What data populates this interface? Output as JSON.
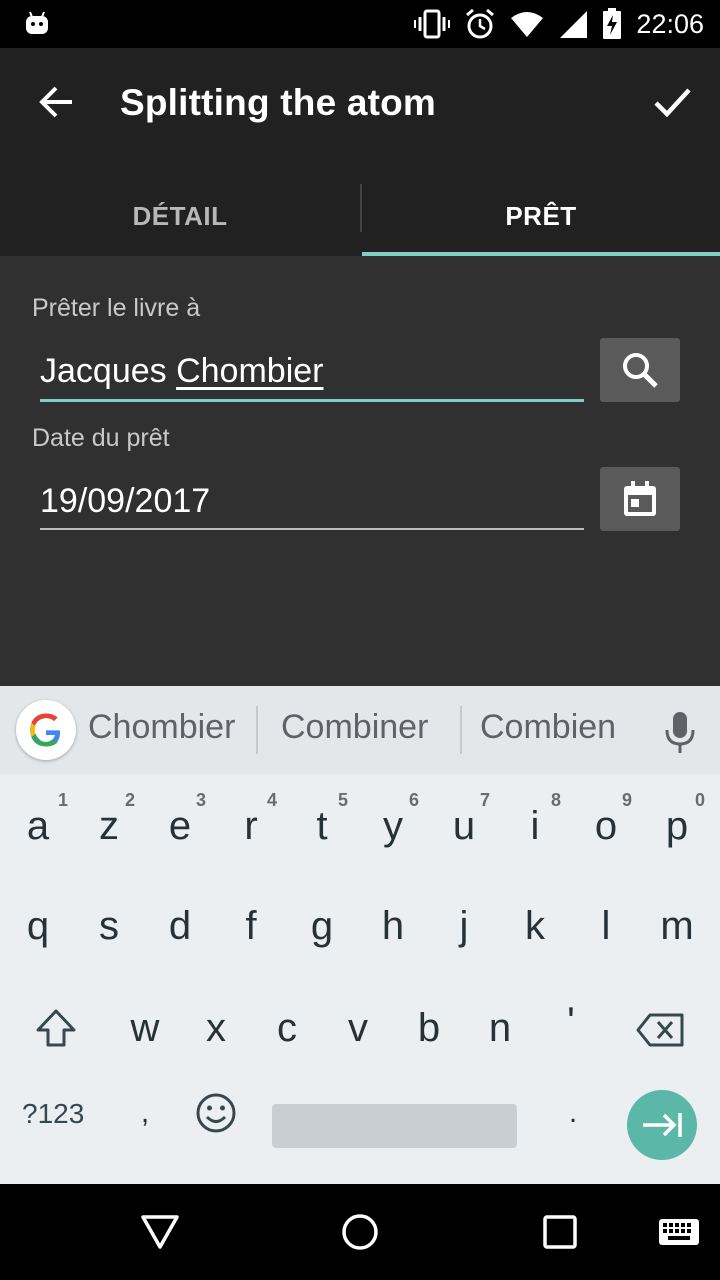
{
  "status_bar": {
    "time": "22:06",
    "icons": [
      "android-debug-icon",
      "vibrate-icon",
      "alarm-icon",
      "wifi-icon",
      "signal-icon",
      "battery-charging-icon"
    ]
  },
  "app_bar": {
    "title": "Splitting the atom",
    "back_icon": "arrow-back-icon",
    "confirm_icon": "check-icon"
  },
  "tabs": [
    {
      "label": "DÉTAIL",
      "selected": false
    },
    {
      "label": "PRÊT",
      "selected": true
    }
  ],
  "form": {
    "borrower_label": "Prêter le livre à",
    "borrower_first": "Jacques",
    "borrower_last": "Chombier",
    "search_icon": "search-icon",
    "date_label": "Date du prêt",
    "date_value": "19/09/2017",
    "calendar_icon": "calendar-icon"
  },
  "keyboard": {
    "suggestions": [
      "Chombier",
      "Combiner",
      "Combien"
    ],
    "row1": [
      "a",
      "z",
      "e",
      "r",
      "t",
      "y",
      "u",
      "i",
      "o",
      "p"
    ],
    "row1_hints": [
      "1",
      "2",
      "3",
      "4",
      "5",
      "6",
      "7",
      "8",
      "9",
      "0"
    ],
    "row2": [
      "q",
      "s",
      "d",
      "f",
      "g",
      "h",
      "j",
      "k",
      "l",
      "m"
    ],
    "row3": [
      "w",
      "x",
      "c",
      "v",
      "b",
      "n",
      "'"
    ],
    "symbols_label": "?123",
    "comma": ",",
    "period": "."
  },
  "colors": {
    "accent": "#7fcfc4",
    "app_bar": "#212121",
    "content_bg": "#303030",
    "keyboard_bg": "#eceff1",
    "enter_key": "#5bb8a9"
  }
}
